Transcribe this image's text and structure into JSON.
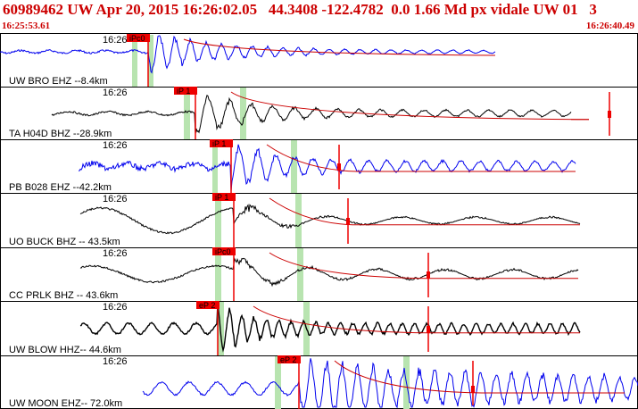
{
  "header": {
    "title": "60989462 UW Apr 20, 2015 16:26:02.05   44.3408 -122.4782  0.0 1.66 Md px vidale UW 01   3",
    "start_time": "16:25:53.61",
    "end_time": "16:26:40.49"
  },
  "colors": {
    "header_text": "#cc0000",
    "trace_blue": "#0000ee",
    "trace_black": "#000000",
    "pick_red": "#ee0000",
    "window_green": "#b8e4b0",
    "coda_curve": "#cc0000"
  },
  "traces": [
    {
      "label": "UW BRO EHZ --8.4km",
      "time_label": "16:26",
      "pick": "iPc0",
      "color": "blue"
    },
    {
      "label": "TA H04D BHZ --28.9km",
      "time_label": "16:26",
      "pick": "iP 1",
      "color": "black"
    },
    {
      "label": "PB B028 EHZ --42.2km",
      "time_label": "16:26",
      "pick": "iP 1",
      "color": "blue"
    },
    {
      "label": "UO BUCK BHZ -- 43.5km",
      "time_label": "16:26",
      "pick": "iP 1",
      "color": "black"
    },
    {
      "label": "CC PRLK BHZ -- 43.6km",
      "time_label": "16:26",
      "pick": "iPc0",
      "color": "black"
    },
    {
      "label": "UW BLOW HHZ-- 44.6km",
      "time_label": "16:26",
      "pick": "eP 2",
      "color": "black"
    },
    {
      "label": "UW MOON EHZ-- 72.0km",
      "time_label": "16:26",
      "pick": "eP 2",
      "color": "blue"
    }
  ]
}
